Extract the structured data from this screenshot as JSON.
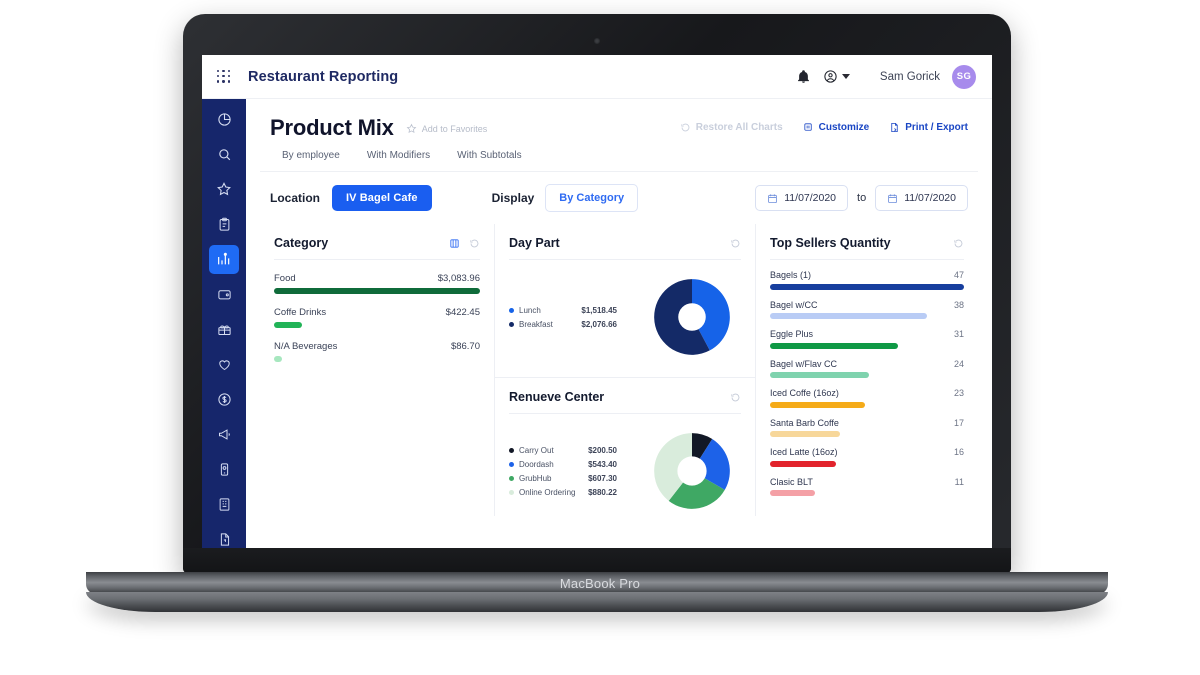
{
  "device": {
    "label": "MacBook Pro"
  },
  "topbar": {
    "app_menu_icon": "grid-apps-icon",
    "brand": "Restaurant Reporting",
    "notification_icon": "bell-icon",
    "account_icon": "account-circle-icon",
    "caret_icon": "chevron-down-icon",
    "user_name": "Sam Gorick",
    "avatar_initials": "SG",
    "avatar_color": "#a78bec"
  },
  "sidebar": {
    "active_index": 4,
    "bg": "#16266b",
    "active_bg": "#1f6bf5",
    "items": [
      {
        "icon": "pie-chart-icon",
        "label": "Dashboard"
      },
      {
        "icon": "search-icon",
        "label": "Search"
      },
      {
        "icon": "star-icon",
        "label": "Favorites"
      },
      {
        "icon": "clipboard-icon",
        "label": "Reports"
      },
      {
        "icon": "bar-chart-icon",
        "label": "Analytics"
      },
      {
        "icon": "wallet-icon",
        "label": "Payments"
      },
      {
        "icon": "gift-icon",
        "label": "Promotions"
      },
      {
        "icon": "heart-icon",
        "label": "Loyalty"
      },
      {
        "icon": "dollar-circle-icon",
        "label": "Sales"
      },
      {
        "icon": "megaphone-icon",
        "label": "Marketing"
      },
      {
        "icon": "mobile-icon",
        "label": "Mobile"
      },
      {
        "icon": "building-icon",
        "label": "Locations"
      },
      {
        "icon": "document-icon",
        "label": "Documents"
      }
    ]
  },
  "page": {
    "title": "Product Mix",
    "favorite_icon": "star-outline-icon",
    "favorite_label": "Add to Favorites",
    "actions": [
      {
        "icon": "restore-icon",
        "label": "Restore All Charts",
        "state": "disabled"
      },
      {
        "icon": "customize-icon",
        "label": "Customize",
        "state": "enabled"
      },
      {
        "icon": "print-export-icon",
        "label": "Print / Export",
        "state": "enabled"
      }
    ],
    "tabs": [
      {
        "label": "By employee",
        "active": false
      },
      {
        "label": "With Modifiers",
        "active": false
      },
      {
        "label": "With Subtotals",
        "active": false
      }
    ]
  },
  "filters": {
    "location_label": "Location",
    "location_value": "IV Bagel Cafe",
    "display_label": "Display",
    "display_value": "By Category",
    "date_from": "11/07/2020",
    "date_to": "11/07/2020",
    "to_word": "to",
    "calendar_icon": "calendar-icon"
  },
  "chart_data": [
    {
      "type": "bar",
      "title": "Category",
      "orientation": "horizontal",
      "value_prefix": "$",
      "tools": [
        "toggle-chart-icon",
        "reset-icon"
      ],
      "categories": [
        "Food",
        "Coffe Drinks",
        "N/A Beverages"
      ],
      "values": [
        3083.96,
        422.45,
        86.7
      ],
      "value_labels": [
        "$3,083.96",
        "$422.45",
        "$86.70"
      ],
      "colors": [
        "#0f6b3a",
        "#21b357",
        "#a7e7bf"
      ],
      "max": 3083.96,
      "xlabel": "",
      "ylabel": ""
    },
    {
      "type": "pie",
      "title": "Day Part",
      "donut": true,
      "tools": [
        "reset-icon"
      ],
      "legend_position": "left",
      "categories": [
        "Lunch",
        "Breakfast"
      ],
      "values": [
        1518.45,
        2076.66
      ],
      "value_labels": [
        "$1,518.45",
        "$2,076.66"
      ],
      "colors": [
        "#1663e8",
        "#142a67"
      ]
    },
    {
      "type": "pie",
      "title": "Renueve Center",
      "donut": true,
      "tools": [
        "reset-icon"
      ],
      "legend_position": "left",
      "categories": [
        "Carry Out",
        "Doordash",
        "GrubHub",
        "Online Ordering"
      ],
      "values": [
        200.5,
        543.4,
        607.3,
        880.22
      ],
      "value_labels": [
        "$200.50",
        "$543.40",
        "$607.30",
        "$880.22"
      ],
      "colors": [
        "#121826",
        "#1d62e8",
        "#3fa864",
        "#d9ecdc"
      ]
    },
    {
      "type": "bar",
      "title": "Top Sellers Quantity",
      "orientation": "horizontal",
      "tools": [
        "reset-icon"
      ],
      "categories": [
        "Bagels (1)",
        "Bagel w/CC",
        "Eggle Plus",
        "Bagel w/Flav CC",
        "Iced Coffe (16oz)",
        "Santa Barb Coffe",
        "Iced Latte (16oz)",
        "Clasic BLT"
      ],
      "values": [
        47,
        38,
        31,
        24,
        23,
        17,
        16,
        11
      ],
      "value_labels": [
        "47",
        "38",
        "31",
        "24",
        "23",
        "17",
        "16",
        "11"
      ],
      "colors": [
        "#173e9e",
        "#b9ccf5",
        "#0f9945",
        "#7fd3ae",
        "#f5ab18",
        "#f7d79a",
        "#e2232c",
        "#f4a0a6"
      ],
      "max": 47,
      "xlabel": "",
      "ylabel": ""
    }
  ]
}
